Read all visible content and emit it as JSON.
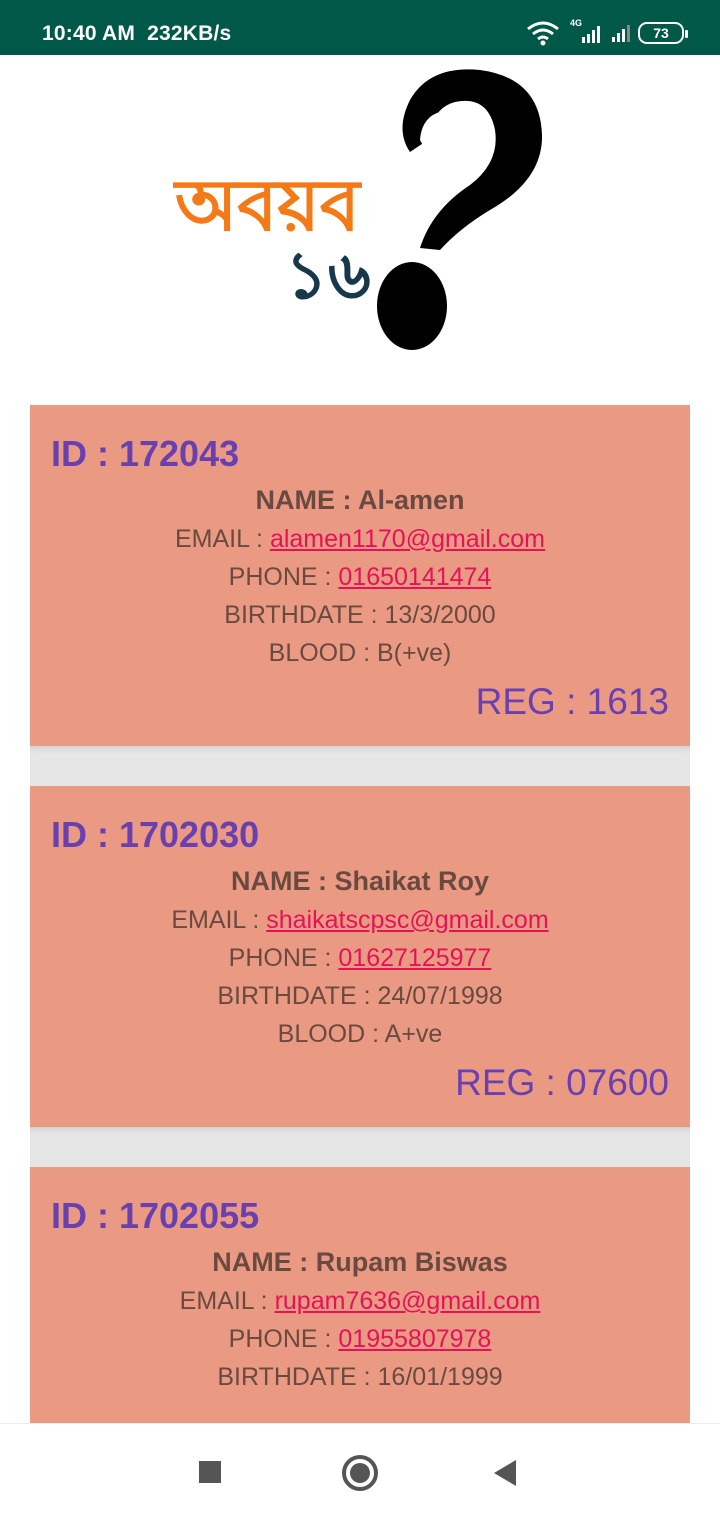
{
  "status_bar": {
    "time": "10:40 AM",
    "speed": "232KB/s",
    "network_label": "4G",
    "battery": "73",
    "icons": [
      "wifi-icon",
      "signal-4g-icon",
      "signal-icon",
      "battery-icon"
    ]
  },
  "logo": {
    "text_main": "অবয়ব",
    "text_number": "১৬",
    "colors": {
      "main": "#f47a17",
      "number": "#16384a",
      "mark": "#000000"
    }
  },
  "cards": [
    {
      "id": "ID : 172043",
      "name": "NAME : Al-amen",
      "email_label": "EMAIL : ",
      "email": "alamen1170@gmail.com",
      "phone_label": "PHONE : ",
      "phone": "01650141474",
      "birthdate": "BIRTHDATE : 13/3/2000",
      "blood": "BLOOD : B(+ve)",
      "reg": "REG : 1613"
    },
    {
      "id": "ID : 1702030",
      "name": "NAME : Shaikat Roy",
      "email_label": "EMAIL : ",
      "email": "shaikatscpsc@gmail.com",
      "phone_label": "PHONE : ",
      "phone": "01627125977",
      "birthdate": "BIRTHDATE : 24/07/1998",
      "blood": "BLOOD : A+ve",
      "reg": "REG : 07600"
    },
    {
      "id": "ID : 1702055",
      "name": "NAME : Rupam Biswas",
      "email_label": "EMAIL : ",
      "email": "rupam7636@gmail.com",
      "phone_label": "PHONE : ",
      "phone": "01955807978",
      "birthdate": "BIRTHDATE : 16/01/1999"
    }
  ],
  "colors": {
    "status_bar": "#005848",
    "card_bg": "#ea9a83",
    "accent_purple": "#6a3fb0",
    "link": "#e5125a"
  }
}
